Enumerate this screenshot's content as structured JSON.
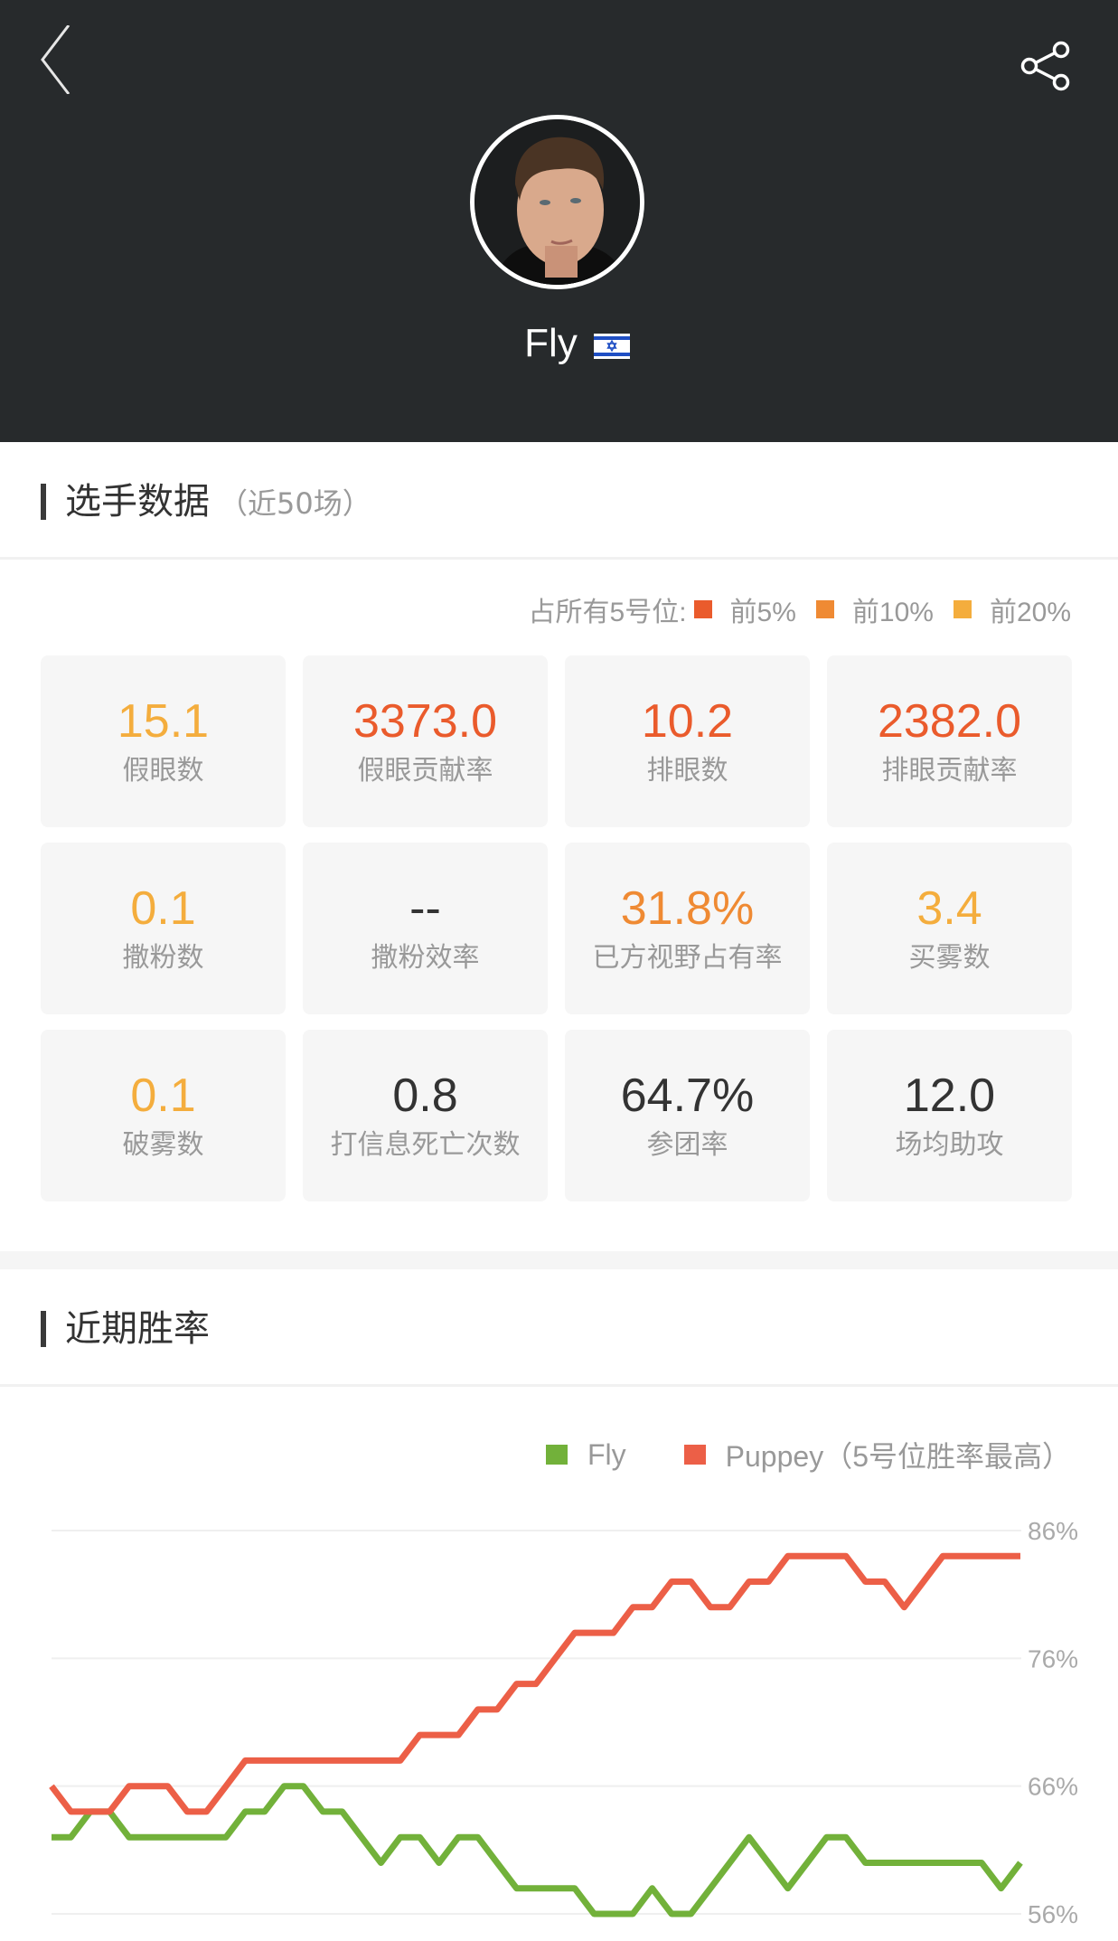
{
  "header": {
    "back_icon": "chevron-left-icon",
    "share_icon": "share-icon",
    "player_name": "Fly",
    "flag_icon": "israel-flag-icon"
  },
  "stats_section": {
    "title": "选手数据",
    "subtitle": "（近50场）",
    "rank_legend": {
      "prefix": "占所有5号位:",
      "items": [
        {
          "label": "前5%",
          "color": "#ea5b2c"
        },
        {
          "label": "前10%",
          "color": "#ef8a33"
        },
        {
          "label": "前20%",
          "color": "#f4ad3d"
        }
      ]
    },
    "cards": [
      {
        "value": "15.1",
        "label": "假眼数",
        "color": "#f4ad3d"
      },
      {
        "value": "3373.0",
        "label": "假眼贡献率",
        "color": "#ea5b2c"
      },
      {
        "value": "10.2",
        "label": "排眼数",
        "color": "#ea5b2c"
      },
      {
        "value": "2382.0",
        "label": "排眼贡献率",
        "color": "#ea5b2c"
      },
      {
        "value": "0.1",
        "label": "撒粉数",
        "color": "#f4ad3d"
      },
      {
        "value": "--",
        "label": "撒粉效率",
        "color": "#333333"
      },
      {
        "value": "31.8%",
        "label": "已方视野占有率",
        "color": "#ef8a33"
      },
      {
        "value": "3.4",
        "label": "买雾数",
        "color": "#f4ad3d"
      },
      {
        "value": "0.1",
        "label": "破雾数",
        "color": "#f4ad3d"
      },
      {
        "value": "0.8",
        "label": "打信息死亡次数",
        "color": "#333333"
      },
      {
        "value": "64.7%",
        "label": "参团率",
        "color": "#333333"
      },
      {
        "value": "12.0",
        "label": "场均助攻",
        "color": "#333333"
      }
    ]
  },
  "winrate_section": {
    "title": "近期胜率"
  },
  "chart_data": {
    "type": "line",
    "title": "近期胜率",
    "xlabel": "",
    "ylabel": "",
    "ylim": [
      56,
      86
    ],
    "yticks": [
      86,
      76,
      66,
      56
    ],
    "ytick_labels": [
      "86%",
      "76%",
      "66%",
      "56%"
    ],
    "grid": true,
    "legend_position": "top-right",
    "x": [
      1,
      2,
      3,
      4,
      5,
      6,
      7,
      8,
      9,
      10,
      11,
      12,
      13,
      14,
      15,
      16,
      17,
      18,
      19,
      20,
      21,
      22,
      23,
      24,
      25,
      26,
      27,
      28,
      29,
      30,
      31,
      32,
      33,
      34,
      35,
      36,
      37,
      38,
      39,
      40,
      41,
      42,
      43,
      44,
      45,
      46,
      47,
      48,
      49,
      50,
      51
    ],
    "series": [
      {
        "name": "Fly",
        "color": "#72b13a",
        "values": [
          62,
          62,
          64,
          64,
          62,
          62,
          62,
          62,
          62,
          62,
          64,
          64,
          66,
          66,
          64,
          64,
          62,
          60,
          62,
          62,
          60,
          62,
          62,
          60,
          58,
          58,
          58,
          58,
          56,
          56,
          56,
          58,
          56,
          56,
          58,
          60,
          62,
          60,
          58,
          60,
          62,
          62,
          60,
          60,
          60,
          60,
          60,
          60,
          60,
          58,
          60
        ]
      },
      {
        "name": "Puppey（5号位胜率最高）",
        "color": "#ec5f47",
        "values": [
          66,
          64,
          64,
          64,
          66,
          66,
          66,
          64,
          64,
          66,
          68,
          68,
          68,
          68,
          68,
          68,
          68,
          68,
          68,
          70,
          70,
          70,
          72,
          72,
          74,
          74,
          76,
          78,
          78,
          78,
          80,
          80,
          82,
          82,
          80,
          80,
          82,
          82,
          84,
          84,
          84,
          84,
          82,
          82,
          80,
          82,
          84,
          84,
          84,
          84,
          84
        ]
      }
    ]
  }
}
